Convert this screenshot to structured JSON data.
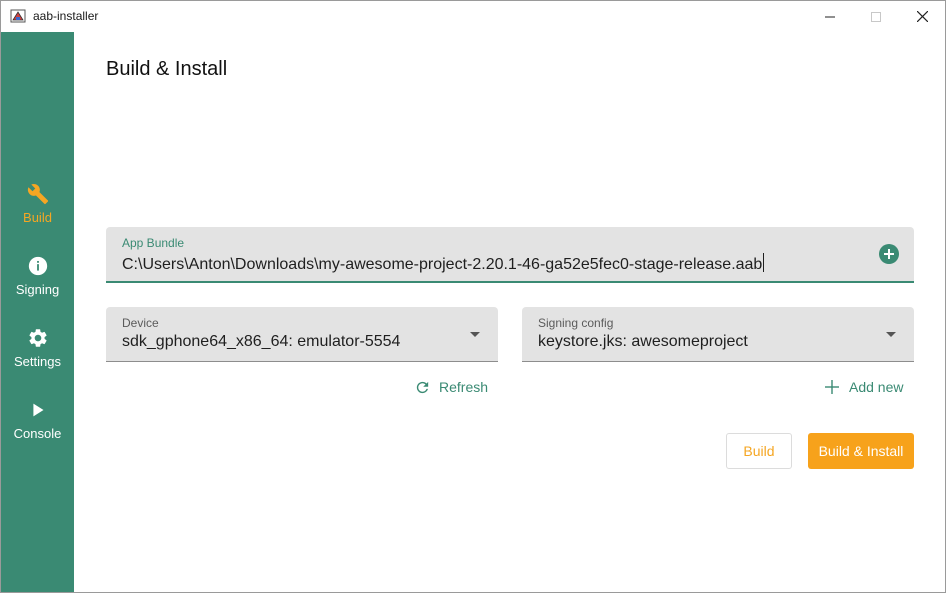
{
  "window": {
    "title": "aab-installer"
  },
  "sidebar": {
    "items": [
      {
        "label": "Build",
        "icon": "wrench-icon",
        "active": true
      },
      {
        "label": "Signing",
        "icon": "info-icon",
        "active": false
      },
      {
        "label": "Settings",
        "icon": "gear-icon",
        "active": false
      },
      {
        "label": "Console",
        "icon": "play-icon",
        "active": false
      }
    ]
  },
  "main": {
    "title": "Build & Install",
    "app_bundle": {
      "label": "App Bundle",
      "value": "C:\\Users\\Anton\\Downloads\\my-awesome-project-2.20.1-46-ga52e5fec0-stage-release.aab"
    },
    "device": {
      "label": "Device",
      "value": "sdk_gphone64_x86_64: emulator-5554"
    },
    "signing_config": {
      "label": "Signing config",
      "value": "keystore.jks: awesomeproject"
    },
    "refresh_label": "Refresh",
    "add_new_label": "Add new",
    "build_label": "Build",
    "build_install_label": "Build & Install"
  },
  "colors": {
    "sidebar_bg": "#3a8a73",
    "accent_green": "#3a8a73",
    "accent_orange": "#f5a623"
  }
}
